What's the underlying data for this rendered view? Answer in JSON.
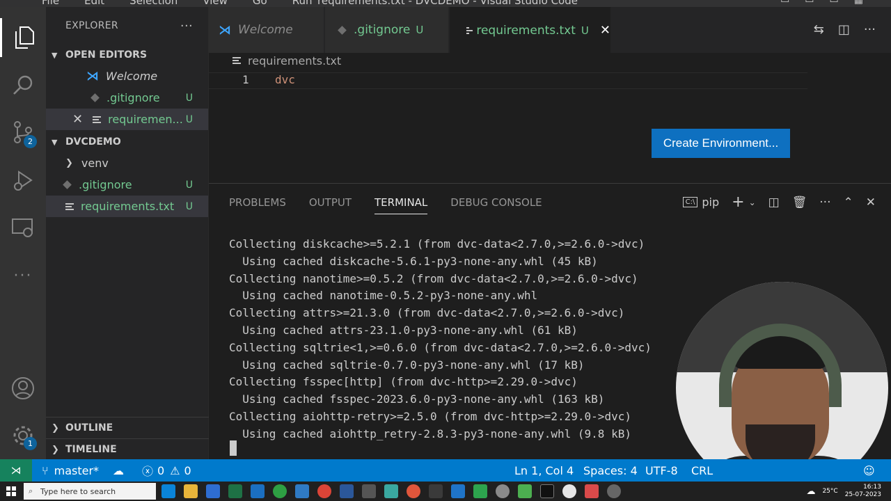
{
  "window": {
    "title": "requirements.txt - DVCDEMO - Visual Studio Code",
    "menu": [
      "File",
      "Edit",
      "Selection",
      "View",
      "Go",
      "Run"
    ]
  },
  "activity_bar": {
    "source_control_badge": "2",
    "settings_badge": "1"
  },
  "explorer": {
    "title": "EXPLORER",
    "more": "···",
    "open_editors": {
      "label": "OPEN EDITORS",
      "items": [
        {
          "name": "Welcome",
          "status": ""
        },
        {
          "name": ".gitignore",
          "status": "U"
        },
        {
          "name": "requiremen...",
          "status": "U"
        }
      ]
    },
    "workspace": {
      "label": "DVCDEMO",
      "items": [
        {
          "name": "venv",
          "status": ""
        },
        {
          "name": ".gitignore",
          "status": "U"
        },
        {
          "name": "requirements.txt",
          "status": "U"
        }
      ]
    },
    "outline_label": "OUTLINE",
    "timeline_label": "TIMELINE"
  },
  "tabs": [
    {
      "label": "Welcome",
      "status": ""
    },
    {
      "label": ".gitignore",
      "status": "U"
    },
    {
      "label": "requirements.txt",
      "status": "U"
    }
  ],
  "editor": {
    "breadcrumb": "requirements.txt",
    "line_number": "1",
    "line_text": "dvc",
    "create_env_button": "Create Environment..."
  },
  "panel": {
    "tabs": [
      "PROBLEMS",
      "OUTPUT",
      "TERMINAL",
      "DEBUG CONSOLE"
    ],
    "active_tab": "TERMINAL",
    "shell": "pip",
    "terminal_lines": [
      "Collecting diskcache>=5.2.1 (from dvc-data<2.7.0,>=2.6.0->dvc)",
      "  Using cached diskcache-5.6.1-py3-none-any.whl (45 kB)",
      "Collecting nanotime>=0.5.2 (from dvc-data<2.7.0,>=2.6.0->dvc)",
      "  Using cached nanotime-0.5.2-py3-none-any.whl",
      "Collecting attrs>=21.3.0 (from dvc-data<2.7.0,>=2.6.0->dvc)",
      "  Using cached attrs-23.1.0-py3-none-any.whl (61 kB)",
      "Collecting sqltrie<1,>=0.6.0 (from dvc-data<2.7.0,>=2.6.0->dvc)",
      "  Using cached sqltrie-0.7.0-py3-none-any.whl (17 kB)",
      "Collecting fsspec[http] (from dvc-http>=2.29.0->dvc)",
      "  Using cached fsspec-2023.6.0-py3-none-any.whl (163 kB)",
      "Collecting aiohttp-retry>=2.5.0 (from dvc-http>=2.29.0->dvc)",
      "  Using cached aiohttp_retry-2.8.3-py3-none-any.whl (9.8 kB)"
    ]
  },
  "status_bar": {
    "branch": "master*",
    "errors": "0",
    "warnings": "0",
    "position": "Ln 1, Col 4",
    "spaces": "Spaces: 4",
    "encoding": "UTF-8",
    "eol": "CRL"
  },
  "taskbar": {
    "search_placeholder": "Type here to search",
    "weather": "25°C",
    "time": "16:13",
    "date": "25-07-2023"
  },
  "colors": {
    "accent": "#007acc",
    "git_untracked": "#73c991",
    "button": "#0e70c0"
  }
}
